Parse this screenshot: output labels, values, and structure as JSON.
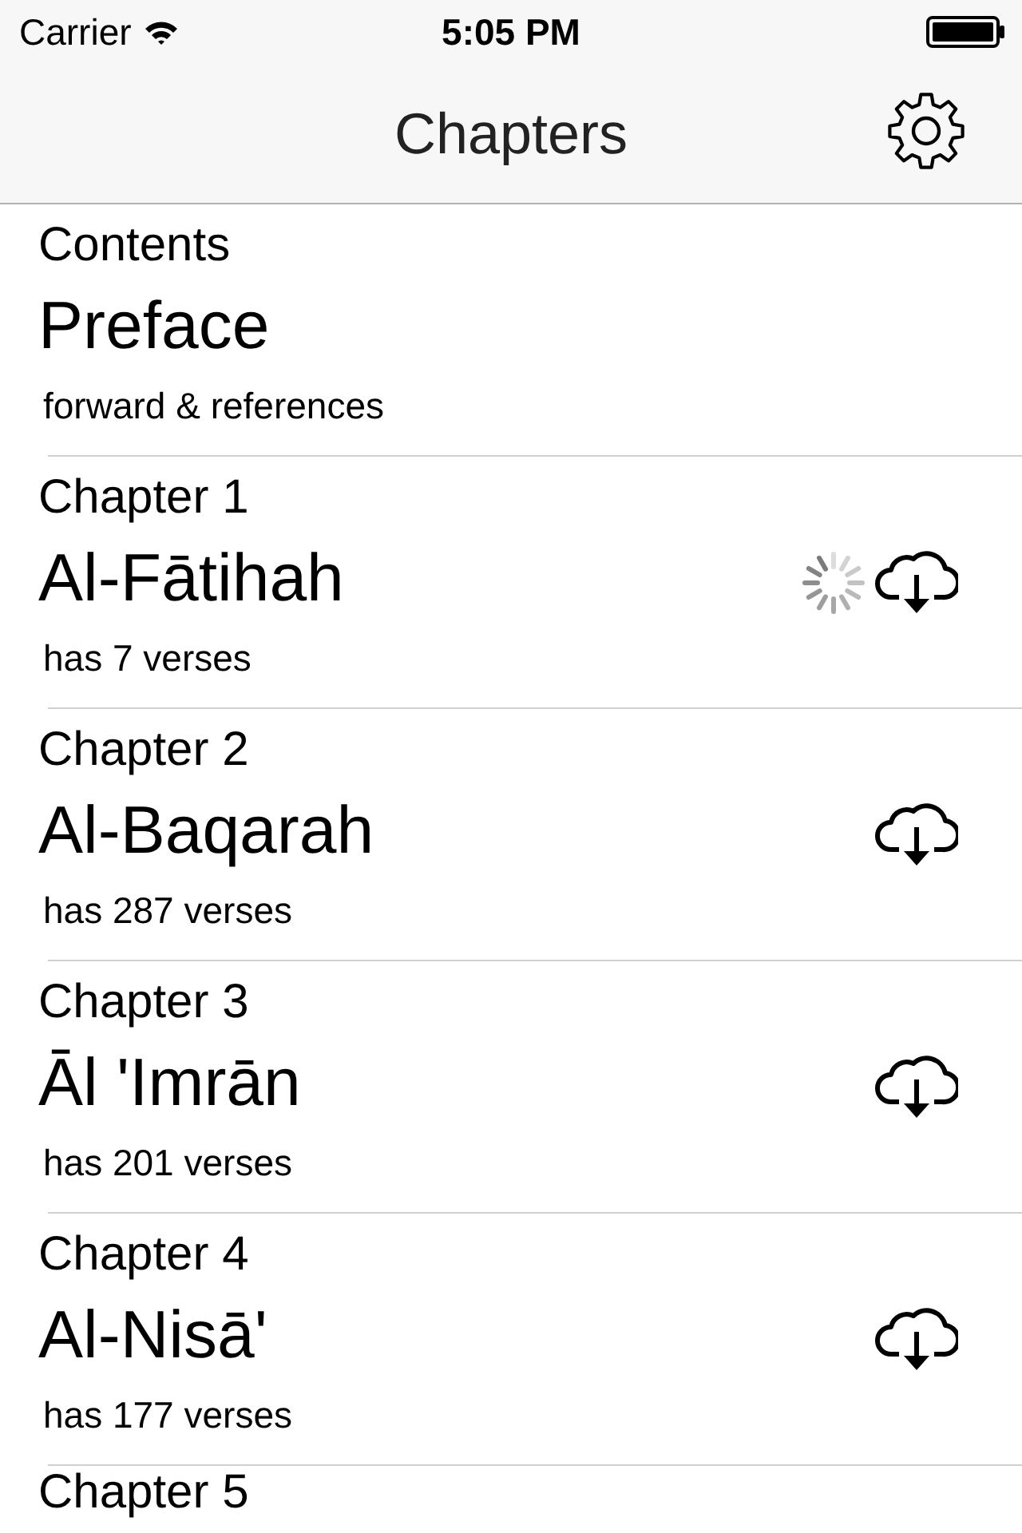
{
  "status_bar": {
    "carrier": "Carrier",
    "time": "5:05 PM"
  },
  "nav": {
    "title": "Chapters"
  },
  "rows": [
    {
      "kind": "contents",
      "label": "Contents",
      "title": "Preface",
      "subtitle": "forward & references"
    },
    {
      "kind": "chapter",
      "label": "Chapter 1",
      "title": "Al-Fātihah",
      "subtitle": "has 7 verses",
      "downloading": true
    },
    {
      "kind": "chapter",
      "label": "Chapter 2",
      "title": "Al-Baqarah",
      "subtitle": "has 287 verses",
      "downloading": false
    },
    {
      "kind": "chapter",
      "label": "Chapter 3",
      "title": "Āl 'Imrān",
      "subtitle": "has 201 verses",
      "downloading": false
    },
    {
      "kind": "chapter",
      "label": "Chapter 4",
      "title": "Al-Nisā'",
      "subtitle": "has 177 verses",
      "downloading": false
    },
    {
      "kind": "partial",
      "label": "Chapter 5"
    }
  ]
}
